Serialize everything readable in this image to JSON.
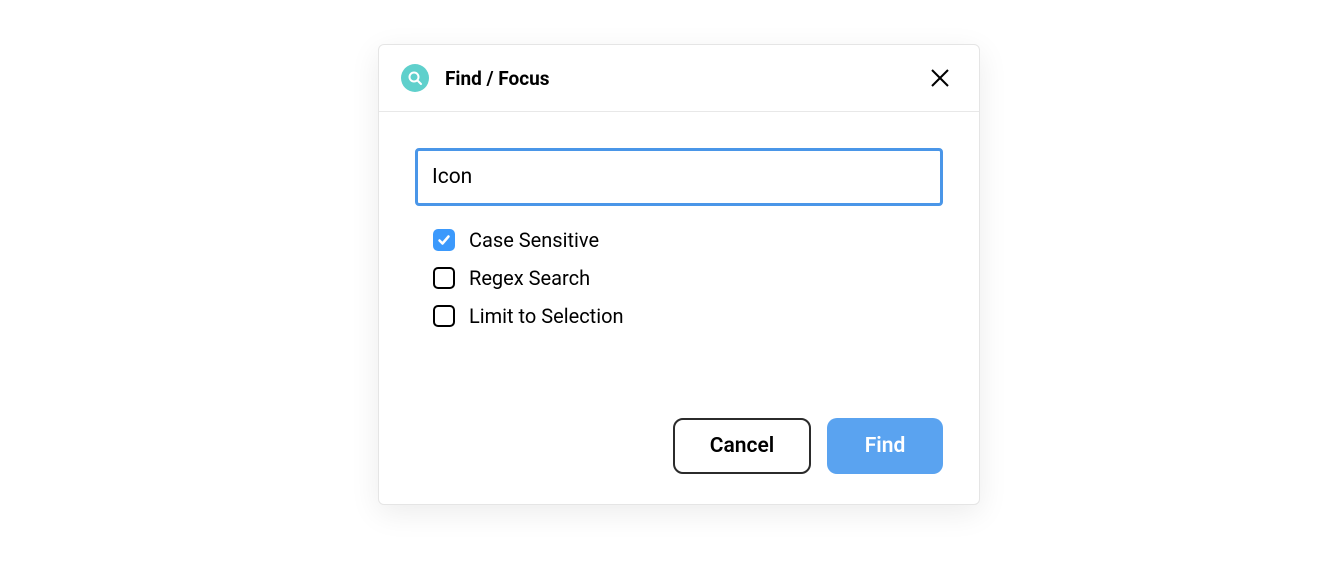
{
  "dialog": {
    "title": "Find / Focus",
    "search_value": "Icon",
    "options": {
      "case_sensitive": {
        "label": "Case Sensitive",
        "checked": true
      },
      "regex_search": {
        "label": "Regex Search",
        "checked": false
      },
      "limit_to_selection": {
        "label": "Limit to Selection",
        "checked": false
      }
    },
    "buttons": {
      "cancel": "Cancel",
      "find": "Find"
    }
  }
}
